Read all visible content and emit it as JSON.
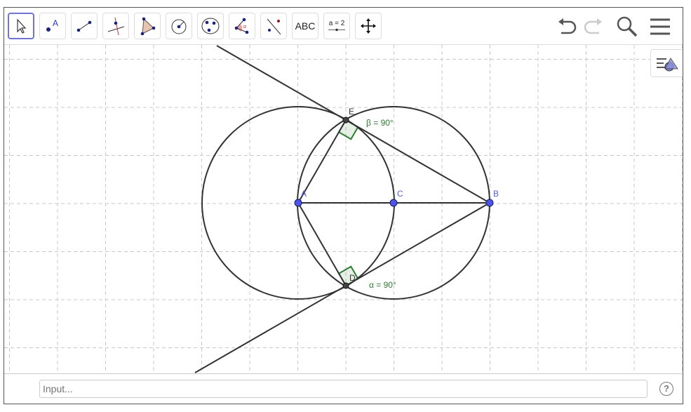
{
  "toolbar": {
    "tools": [
      "Move",
      "Point",
      "Segment",
      "Perpendicular Line",
      "Polygon",
      "Circle with Center",
      "Circle through 3 Points",
      "Angle",
      "Reflect about Line",
      "Text",
      "Slider",
      "Move Graphics View"
    ],
    "text_tool_label": "ABC",
    "slider_tool_label": "a = 2"
  },
  "points": {
    "A": "A",
    "B": "B",
    "C": "C",
    "D": "D",
    "E": "E"
  },
  "angles": {
    "beta": "β = 90°",
    "alpha": "α = 90°"
  },
  "input": {
    "placeholder": "Input..."
  },
  "help": "?",
  "colors": {
    "point": "#4d55e6",
    "angle": "#2e7d32",
    "line": "#333333",
    "accent": "#6f75d1"
  }
}
